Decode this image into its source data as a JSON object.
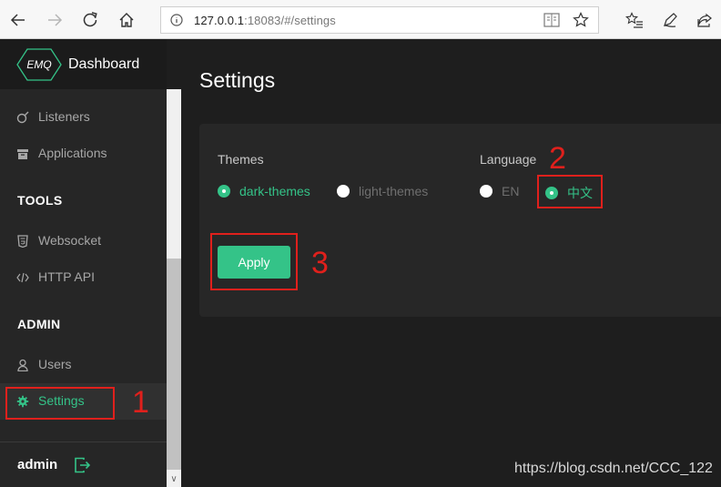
{
  "browser": {
    "url_host": "127.0.0.1",
    "url_rest": ":18083/#/settings"
  },
  "brand": {
    "logo_text": "EMQ",
    "title": "Dashboard"
  },
  "sidebar": {
    "items_top": [
      {
        "label": "Listeners",
        "icon": "listeners-icon"
      },
      {
        "label": "Applications",
        "icon": "applications-icon"
      }
    ],
    "tools_title": "TOOLS",
    "tools_items": [
      {
        "label": "Websocket",
        "icon": "html5-icon"
      },
      {
        "label": "HTTP API",
        "icon": "code-icon"
      }
    ],
    "admin_title": "ADMIN",
    "admin_items": [
      {
        "label": "Users",
        "icon": "user-icon"
      },
      {
        "label": "Settings",
        "icon": "gear-icon",
        "active": true
      }
    ],
    "user": "admin"
  },
  "main": {
    "title": "Settings",
    "themes_label": "Themes",
    "themes_options": [
      {
        "label": "dark-themes",
        "checked": true
      },
      {
        "label": "light-themes",
        "checked": false
      }
    ],
    "language_label": "Language",
    "language_options": [
      {
        "label": "EN",
        "checked": false
      },
      {
        "label": "中文",
        "checked": true
      }
    ],
    "apply_label": "Apply"
  },
  "annotations": [
    "1",
    "2",
    "3"
  ],
  "watermark": "https://blog.csdn.net/CCC_122",
  "colors": {
    "accent": "#34c388",
    "sidebar_bg": "#262626",
    "main_bg": "#1e1e1e",
    "annotation": "#e0201c"
  }
}
